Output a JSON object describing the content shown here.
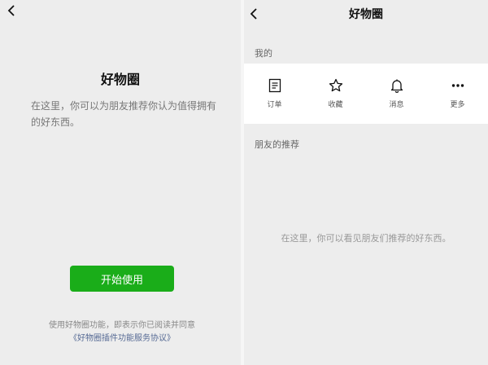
{
  "left": {
    "title": "好物圈",
    "description": "在这里，你可以为朋友推荐你认为值得拥有的好东西。",
    "start_button": "开始使用",
    "agreement_text": "使用好物圈功能，即表示你已阅读并同意",
    "agreement_link": "《好物圈插件功能服务协议》"
  },
  "right": {
    "title": "好物圈",
    "mine_label": "我的",
    "mine_items": [
      {
        "label": "订单",
        "icon": "order-icon"
      },
      {
        "label": "收藏",
        "icon": "star-icon"
      },
      {
        "label": "消息",
        "icon": "bell-icon"
      },
      {
        "label": "更多",
        "icon": "more-icon"
      }
    ],
    "friends_label": "朋友的推荐",
    "empty_text": "在这里，你可以看见朋友们推荐的好东西。"
  },
  "colors": {
    "background": "#ededed",
    "primary_green": "#1aad19",
    "link_blue": "#576b95"
  }
}
